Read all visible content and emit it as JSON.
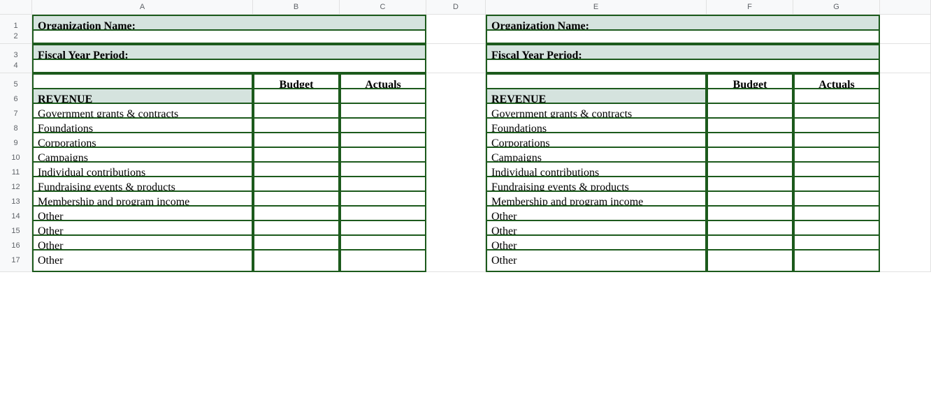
{
  "columns": [
    "A",
    "B",
    "C",
    "D",
    "E",
    "F",
    "G"
  ],
  "rows": [
    "1",
    "2",
    "3",
    "4",
    "5",
    "6",
    "7",
    "8",
    "9",
    "10",
    "11",
    "12",
    "13",
    "14",
    "15",
    "16",
    "17"
  ],
  "labels": {
    "orgName": "Organization Name:",
    "fiscalYear": "Fiscal Year Period:",
    "budget": "Budget",
    "actuals": "Actuals",
    "revenue": "REVENUE"
  },
  "revenueItems": [
    "Government grants & contracts",
    "Foundations",
    "Corporations",
    "Campaigns",
    "Individual contributions",
    "Fundraising events & products",
    "Membership and program income",
    "Other",
    "Other",
    "Other",
    "Other"
  ]
}
